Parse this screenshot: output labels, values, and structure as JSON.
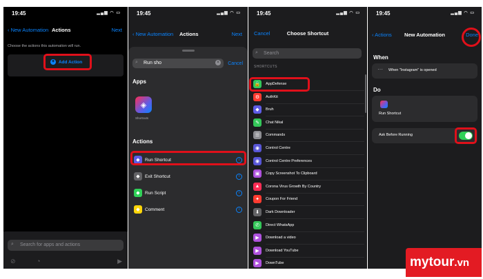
{
  "panel1": {
    "time": "19:45",
    "back_label": "New Automation",
    "title": "Actions",
    "next_label": "Next",
    "hint": "Choose the actions this automation will run.",
    "add_action_label": "Add Action",
    "search_placeholder": "Search for apps and actions"
  },
  "panel2": {
    "time": "19:45",
    "back_label": "New Automation",
    "title": "Actions",
    "next_label": "Next",
    "search_value": "Run sho",
    "cancel_label": "Cancel",
    "apps_header": "Apps",
    "app_name": "Shortcuts",
    "actions_header": "Actions",
    "actions": [
      {
        "label": "Run Shortcut",
        "icon": "shortcuts-icon",
        "color": "#5e5ce6"
      },
      {
        "label": "Exit Shortcut",
        "icon": "exit-icon",
        "color": "#636366"
      },
      {
        "label": "Run Script",
        "icon": "script-icon",
        "color": "#30d158"
      },
      {
        "label": "Comment",
        "icon": "comment-icon",
        "color": "#ffd60a"
      }
    ]
  },
  "panel3": {
    "time": "19:45",
    "cancel_label": "Cancel",
    "title": "Choose Shortcut",
    "search_placeholder": "Search",
    "section_label": "SHORTCUTS",
    "items": [
      {
        "label": "AppDefense",
        "color": "#34c759",
        "glyph": "🔒"
      },
      {
        "label": "AuthKit",
        "color": "#ff3b30",
        "glyph": "⚙"
      },
      {
        "label": "Bruh",
        "color": "#5e5ce6",
        "glyph": "◆"
      },
      {
        "label": "Chat Nikal",
        "color": "#34c759",
        "glyph": "✎"
      },
      {
        "label": "Commands",
        "color": "#8e8e93",
        "glyph": "☰"
      },
      {
        "label": "Control Centre",
        "color": "#5856d6",
        "glyph": "◉"
      },
      {
        "label": "Control Centre Preferences",
        "color": "#5856d6",
        "glyph": "◉"
      },
      {
        "label": "Copy Screenshot To Clipboard",
        "color": "#af52de",
        "glyph": "▣"
      },
      {
        "label": "Corona Virus Growth By Country",
        "color": "#ff2d55",
        "glyph": "▲"
      },
      {
        "label": "Coupon For Friend",
        "color": "#ff3b30",
        "glyph": "✦"
      },
      {
        "label": "Dark Downloader",
        "color": "#636366",
        "glyph": "⬇"
      },
      {
        "label": "Direct WhatsApp",
        "color": "#34c759",
        "glyph": "✆"
      },
      {
        "label": "Download a video",
        "color": "#af52de",
        "glyph": "▶"
      },
      {
        "label": "Download YouTube",
        "color": "#af52de",
        "glyph": "▶"
      },
      {
        "label": "DownTube",
        "color": "#af52de",
        "glyph": "▶"
      }
    ]
  },
  "panel4": {
    "time": "19:45",
    "back_label": "Actions",
    "title": "New Automation",
    "done_label": "Done",
    "when_header": "When",
    "when_text": "When \"Instagram\" is opened",
    "do_header": "Do",
    "do_action": "Run Shortcut",
    "ask_label": "Ask Before Running",
    "ask_enabled": true
  },
  "watermark": {
    "brand": "mytour",
    "tld": ".vn"
  },
  "colors": {
    "accent": "#0a84ff",
    "highlight": "#e0101a",
    "toggle_on": "#30d158"
  }
}
